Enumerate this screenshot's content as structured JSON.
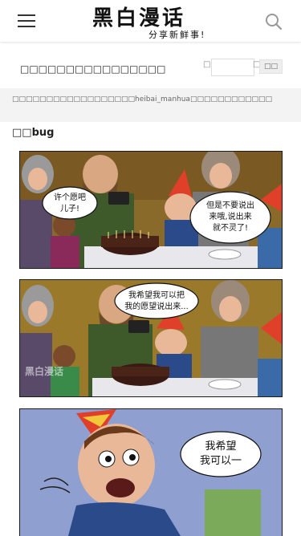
{
  "header": {
    "logo_main": "黑白漫话",
    "logo_sub": "分享新鲜事!"
  },
  "article": {
    "title": "□□□□□□□□□□□□□□□□",
    "pagination": {
      "prefix": "□",
      "input_value": "",
      "suffix": "□",
      "go_label": "□□"
    },
    "notice": "□□□□□□□□□□□□□□□□□□heibai_manhua□□□□□□□□□□□□",
    "section_title": "□□bug"
  },
  "comic": {
    "panel1": {
      "bubble_left": [
        "许个愿吧",
        "儿子!"
      ],
      "bubble_right": [
        "但是不要说出",
        "来哦,说出来",
        "就不灵了!"
      ]
    },
    "panel2": {
      "bubble": [
        "我希望我可以把",
        "我的愿望说出来..."
      ],
      "watermark": "黑白漫话"
    },
    "panel3": {
      "bubble": [
        "我希望",
        "我可以一"
      ]
    }
  },
  "colors": {
    "accent": "#333333",
    "panel_bg_warm": "#8a6a2a",
    "panel_bg_cool": "#8f9fd0"
  }
}
